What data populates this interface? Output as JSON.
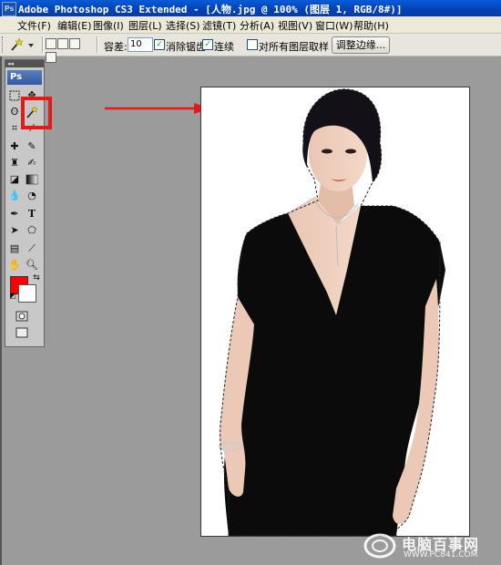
{
  "window": {
    "title": "Adobe Photoshop CS3 Extended - [人物.jpg @ 100% (图层 1, RGB/8#)]",
    "app_icon": "Ps"
  },
  "menu": [
    {
      "label": "文件(F)"
    },
    {
      "label": "编辑(E)"
    },
    {
      "label": "图像(I)"
    },
    {
      "label": "图层(L)"
    },
    {
      "label": "选择(S)"
    },
    {
      "label": "滤镜(T)"
    },
    {
      "label": "分析(A)"
    },
    {
      "label": "视图(V)"
    },
    {
      "label": "窗口(W)"
    },
    {
      "label": "帮助(H)"
    }
  ],
  "options": {
    "tolerance_label": "容差:",
    "tolerance_value": "10",
    "antialias_label": "消除锯齿",
    "antialias_checked": true,
    "contiguous_label": "连续",
    "contiguous_checked": true,
    "sample_all_label": "对所有图层取样",
    "sample_all_checked": false,
    "refine_edge_label": "调整边缘..."
  },
  "toolbox": {
    "header": "◂◂",
    "logo": "Ps",
    "active_tool": "magic-wand",
    "foreground_color": "#ff0000",
    "background_color": "#ffffff"
  },
  "annotation": {
    "highlight_color": "#e81818",
    "arrow_color": "#e81818"
  },
  "watermark": {
    "name": "电脑百事网",
    "url": "WWW.PC841.COM"
  }
}
